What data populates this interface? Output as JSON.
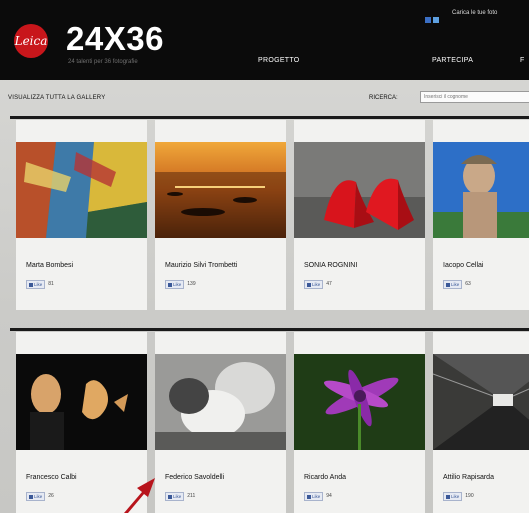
{
  "header": {
    "logo_text": "Leica",
    "title": "24X36",
    "tagline": "24 talenti per 36 fotografie",
    "upload_link": "Carica le tue foto",
    "nav": [
      "PROGETTO",
      "PARTECIPA",
      "F"
    ]
  },
  "toolbar": {
    "view_all": "VISUALIZZA TUTTA LA GALLERY",
    "search_label": "RICERCA:",
    "search_placeholder": "Inserisci il cognome"
  },
  "gallery": [
    {
      "name": "Marta Bombesi",
      "likes": "81"
    },
    {
      "name": "Maurizio Silvi Trombetti",
      "likes": "139"
    },
    {
      "name": "SONIA ROGNINI",
      "likes": "47"
    },
    {
      "name": "Iacopo Cellai",
      "likes": "63"
    },
    {
      "name": "Francesco Calbi",
      "likes": "26"
    },
    {
      "name": "Federico Savoldelli",
      "likes": "211"
    },
    {
      "name": "Ricardo Anda",
      "likes": "94"
    },
    {
      "name": "Attilio Rapisarda",
      "likes": "190"
    }
  ],
  "like_label": "Like",
  "colors": {
    "header_bg": "#0b0b0b",
    "logo_red": "#c8161b",
    "arrow_red": "#b8141c",
    "like_blue": "#3b5998"
  }
}
